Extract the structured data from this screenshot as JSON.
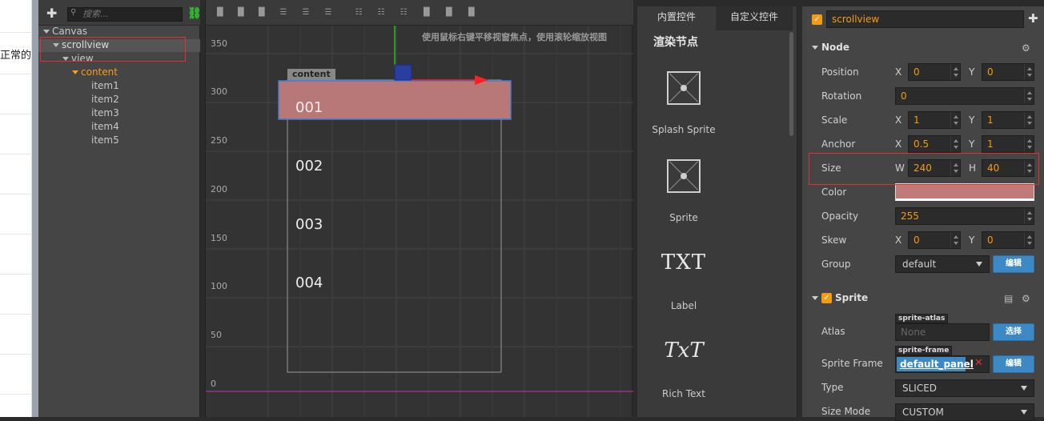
{
  "left_strip": {
    "text": "正常的"
  },
  "hierarchy": {
    "search_placeholder": "搜索...",
    "nodes": [
      {
        "label": "Canvas"
      },
      {
        "label": "scrollview"
      },
      {
        "label": "view"
      },
      {
        "label": "content"
      },
      {
        "label": "item1"
      },
      {
        "label": "item2"
      },
      {
        "label": "item3"
      },
      {
        "label": "item4"
      },
      {
        "label": "item5"
      }
    ]
  },
  "scene": {
    "hint": "使用鼠标右键平移视窗焦点，使用滚轮缩放视图",
    "y_ticks": [
      "350",
      "300",
      "250",
      "200",
      "150",
      "100",
      "50",
      "0"
    ],
    "content_tag": "content",
    "items": [
      "001",
      "002",
      "003",
      "004"
    ],
    "colors": {
      "content_fill": "#b87878",
      "outline": "#3d7fd1",
      "x_axis": "#ff2020",
      "y_axis": "#22c022",
      "baseline": "#c030c0"
    }
  },
  "library": {
    "tabs": [
      "内置控件",
      "自定义控件"
    ],
    "section": "渲染节点",
    "items": [
      {
        "label": "Splash Sprite",
        "icon": "splash-sprite-icon"
      },
      {
        "label": "Sprite",
        "icon": "sprite-icon"
      },
      {
        "label": "Label",
        "big": "TXT"
      },
      {
        "label": "Rich Text",
        "big": "TxT"
      }
    ]
  },
  "inspector": {
    "node_name": "scrollview",
    "node_section": "Node",
    "props": {
      "position": {
        "label": "Position",
        "x": "0",
        "y": "0"
      },
      "rotation": {
        "label": "Rotation",
        "value": "0"
      },
      "scale": {
        "label": "Scale",
        "x": "1",
        "y": "1"
      },
      "anchor": {
        "label": "Anchor",
        "x": "0.5",
        "y": "1"
      },
      "size": {
        "label": "Size",
        "w": "240",
        "h": "40"
      },
      "color": {
        "label": "Color",
        "value": "#c17a78"
      },
      "opacity": {
        "label": "Opacity",
        "value": "255"
      },
      "skew": {
        "label": "Skew",
        "x": "0",
        "y": "0"
      },
      "group": {
        "label": "Group",
        "value": "default",
        "button": "编辑"
      }
    },
    "axes": {
      "x": "X",
      "y": "Y",
      "w": "W",
      "h": "H"
    },
    "sprite_section": "Sprite",
    "atlas": {
      "label": "Atlas",
      "tag": "sprite-atlas",
      "value": "None",
      "button": "选择"
    },
    "sprite_frame": {
      "label": "Sprite Frame",
      "tag": "sprite-frame",
      "value": "default_panel",
      "button": "编辑"
    },
    "type": {
      "label": "Type",
      "value": "SLICED"
    },
    "size_mode": {
      "label": "Size Mode",
      "value": "CUSTOM"
    }
  }
}
